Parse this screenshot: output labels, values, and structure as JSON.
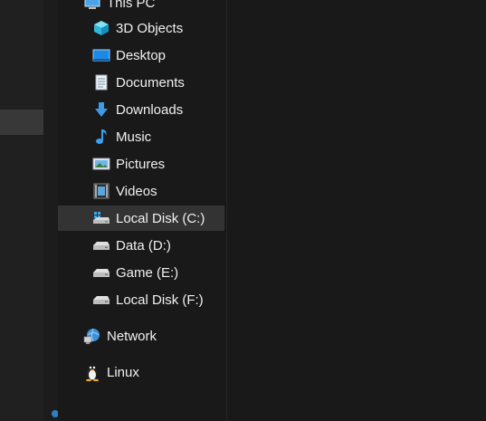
{
  "nav": {
    "this_pc": {
      "label": "This PC",
      "icon": "this-pc-icon"
    },
    "items": [
      {
        "label": "3D Objects",
        "icon": "3d-objects-icon"
      },
      {
        "label": "Desktop",
        "icon": "desktop-icon"
      },
      {
        "label": "Documents",
        "icon": "documents-icon"
      },
      {
        "label": "Downloads",
        "icon": "downloads-icon"
      },
      {
        "label": "Music",
        "icon": "music-icon"
      },
      {
        "label": "Pictures",
        "icon": "pictures-icon"
      },
      {
        "label": "Videos",
        "icon": "videos-icon"
      },
      {
        "label": "Local Disk (C:)",
        "icon": "windows-drive-icon",
        "selected": true
      },
      {
        "label": "Data (D:)",
        "icon": "drive-icon"
      },
      {
        "label": "Game (E:)",
        "icon": "drive-icon"
      },
      {
        "label": "Local Disk (F:)",
        "icon": "drive-icon"
      }
    ],
    "network": {
      "label": "Network",
      "icon": "network-icon"
    },
    "linux": {
      "label": "Linux",
      "icon": "linux-penguin-icon"
    }
  },
  "colors": {
    "background": "#191919",
    "selected": "#333333",
    "text": "#f0f0f0",
    "accent": "#2d7fc7"
  }
}
